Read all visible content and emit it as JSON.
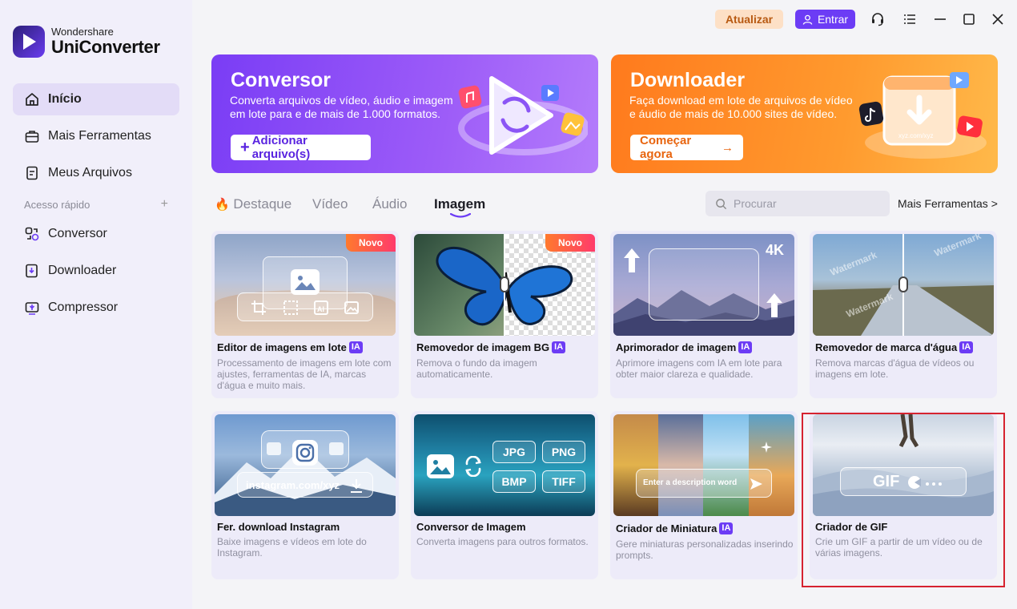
{
  "app": {
    "brand_top": "Wondershare",
    "brand_main": "UniConverter"
  },
  "sidebar": {
    "items": [
      {
        "label": "Início",
        "icon": "home-icon"
      },
      {
        "label": "Mais Ferramentas",
        "icon": "toolbox-icon"
      },
      {
        "label": "Meus Arquivos",
        "icon": "file-icon"
      }
    ],
    "quick_access_label": "Acesso rápido",
    "quick_items": [
      {
        "label": "Conversor",
        "icon": "converter-icon"
      },
      {
        "label": "Downloader",
        "icon": "downloader-icon"
      },
      {
        "label": "Compressor",
        "icon": "compressor-icon"
      }
    ]
  },
  "topbar": {
    "update_label": "Atualizar",
    "login_label": "Entrar"
  },
  "banners": {
    "converter": {
      "title": "Conversor",
      "desc": "Converta arquivos de vídeo, áudio e imagem em lote para e de mais de 1.000 formatos.",
      "button": "Adicionar arquivo(s)"
    },
    "downloader": {
      "title": "Downloader",
      "desc": "Faça download em lote de arquivos de vídeo e áudio de mais de 10.000 sites de vídeo.",
      "button": "Começar agora",
      "art_url": "xyz.com/xyz"
    }
  },
  "tabs": [
    "Destaque",
    "Vídeo",
    "Áudio",
    "Imagem"
  ],
  "active_tab": "Imagem",
  "search": {
    "placeholder": "Procurar"
  },
  "more_tools": "Mais Ferramentas >",
  "badges": {
    "ia": "IA",
    "novo": "Novo",
    "k4": "4K",
    "watermark": "Watermark"
  },
  "cards": [
    {
      "title": "Editor de imagens em lote",
      "desc": "Processamento de imagens em lote com ajustes, ferramentas de IA, marcas d'água e muito mais."
    },
    {
      "title": "Removedor de imagem BG",
      "desc": "Remova o fundo da imagem automaticamente."
    },
    {
      "title": "Aprimorador de imagem",
      "desc": "Aprimore imagens com IA em lote para obter maior clareza e qualidade."
    },
    {
      "title": "Removedor de marca d'água",
      "desc": "Remova marcas d'água de vídeos ou imagens em lote."
    },
    {
      "title": "Fer. download Instagram",
      "desc": "Baixe imagens e vídeos em lote do Instagram.",
      "art_url": "instagram.com/xyz"
    },
    {
      "title": "Conversor de Imagem",
      "desc": "Converta imagens para outros formatos.",
      "formats": [
        "JPG",
        "PNG",
        "BMP",
        "TIFF"
      ]
    },
    {
      "title": "Criador de Miniatura",
      "desc": "Gere miniaturas personalizadas inserindo prompts.",
      "prompt": "Enter a description word"
    },
    {
      "title": "Criador de GIF",
      "desc": "Crie um GIF a partir de um vídeo ou de várias imagens.",
      "art_label": "GIF"
    }
  ],
  "colors": {
    "accent": "#6c3cf5",
    "update_bg": "#fde0c6",
    "highlight": "#d6232f"
  }
}
